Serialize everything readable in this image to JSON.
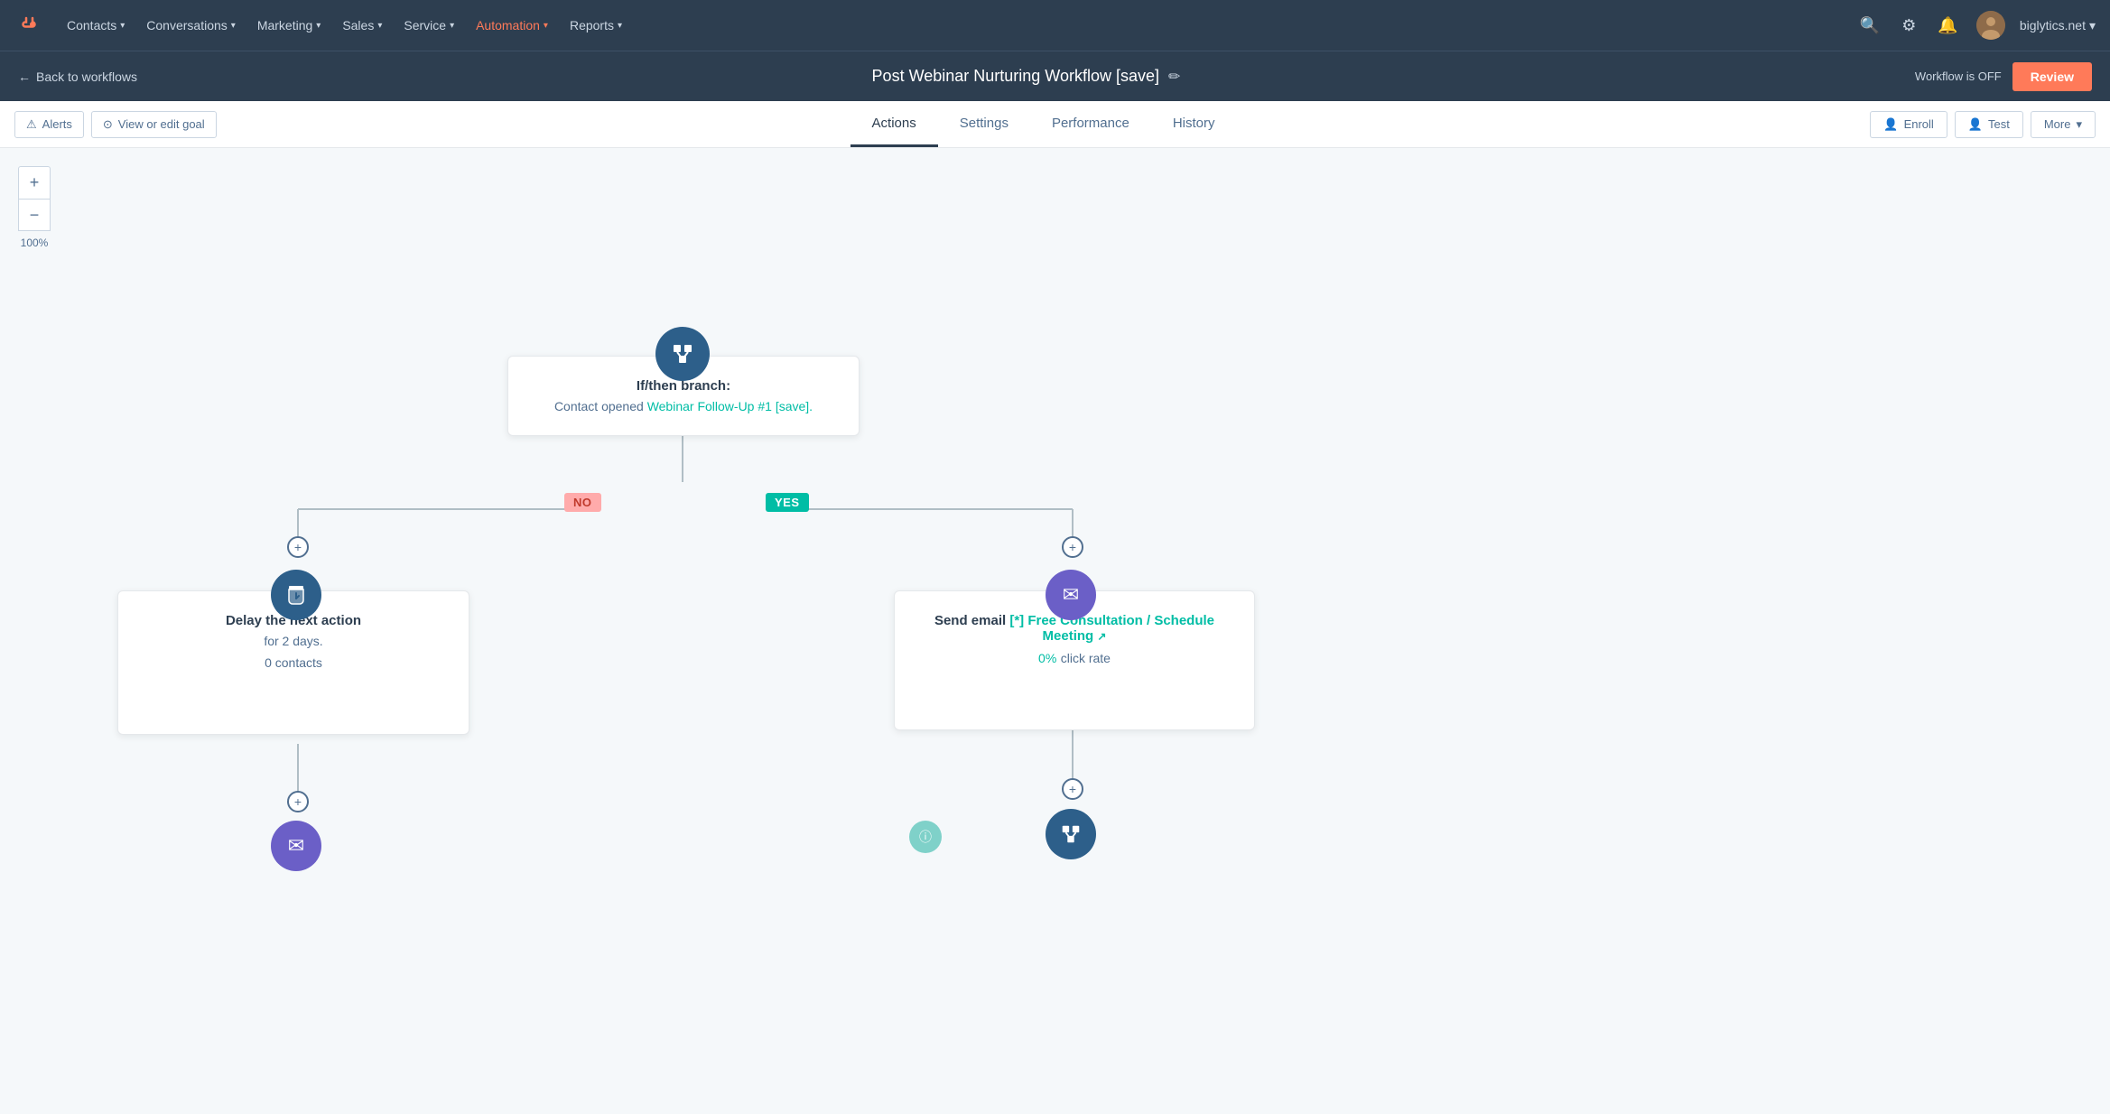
{
  "nav": {
    "logo": "⬡",
    "items": [
      {
        "label": "Contacts",
        "id": "contacts"
      },
      {
        "label": "Conversations",
        "id": "conversations"
      },
      {
        "label": "Marketing",
        "id": "marketing"
      },
      {
        "label": "Sales",
        "id": "sales"
      },
      {
        "label": "Service",
        "id": "service"
      },
      {
        "label": "Automation",
        "id": "automation"
      },
      {
        "label": "Reports",
        "id": "reports"
      }
    ],
    "account": "biglytics.net"
  },
  "workflow_header": {
    "back_label": "Back to workflows",
    "title": "Post Webinar Nurturing Workflow [save]",
    "status": "Workflow is OFF",
    "review_label": "Review"
  },
  "toolbar": {
    "alerts_label": "Alerts",
    "view_goal_label": "View or edit goal",
    "tabs": [
      {
        "label": "Actions",
        "active": true
      },
      {
        "label": "Settings",
        "active": false
      },
      {
        "label": "Performance",
        "active": false
      },
      {
        "label": "History",
        "active": false
      }
    ],
    "enroll_label": "Enroll",
    "test_label": "Test",
    "more_label": "More"
  },
  "canvas": {
    "zoom_level": "100%",
    "zoom_in": "+",
    "zoom_out": "−"
  },
  "nodes": {
    "branch_node": {
      "title": "If/then branch:",
      "desc": "Contact opened",
      "link_text": "Webinar Follow-Up #1 [save].",
      "icon": "⊞"
    },
    "no_label": "NO",
    "yes_label": "YES",
    "delay_node": {
      "title": "Delay the next action",
      "desc": "for 2 days.",
      "contacts": "0 contacts",
      "icon": "⌛"
    },
    "send_email_node": {
      "title": "Send email",
      "link_text": "[*] Free Consultation / Schedule Meeting",
      "rate": "0%",
      "rate_label": "click rate",
      "icon": "✉"
    }
  }
}
